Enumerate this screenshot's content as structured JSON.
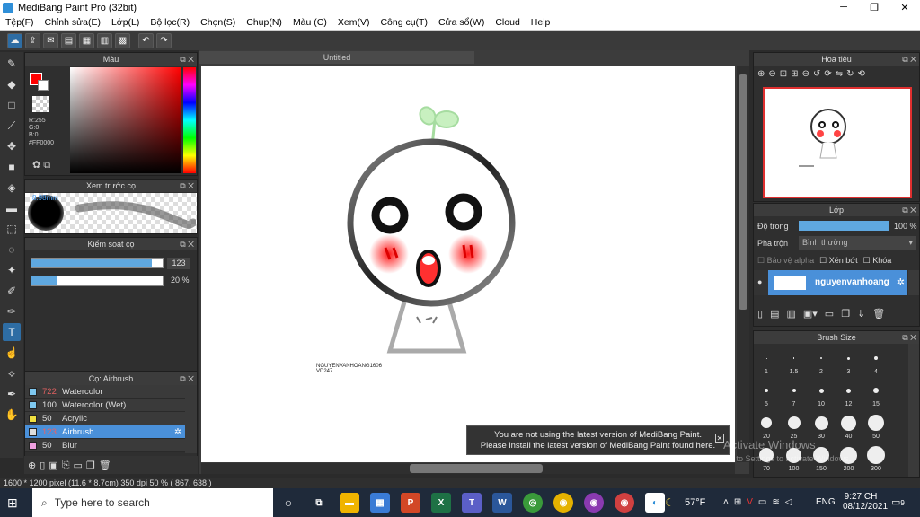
{
  "app": {
    "title": "MediBang Paint Pro (32bit)"
  },
  "menu": [
    "Tệp(F)",
    "Chỉnh sửa(E)",
    "Lớp(L)",
    "Bộ lọc(R)",
    "Chọn(S)",
    "Chụp(N)",
    "Màu (C)",
    "Xem(V)",
    "Công cụ(T)",
    "Cửa sổ(W)",
    "Cloud",
    "Help"
  ],
  "panels": {
    "color": "Màu",
    "preview": "Xem trước cọ",
    "control": "Kiểm soát cọ",
    "brush": "Cọ: Airbrush",
    "navigator": "Hoa tiêu",
    "layer": "Lớp",
    "brushsize": "Brush Size"
  },
  "color": {
    "r": "R:255",
    "g": "G:0",
    "b": "B:0",
    "hex": "#FF0000",
    "primary": "#ff0000"
  },
  "preview": {
    "size": "8.98mm"
  },
  "control": {
    "size": "123",
    "opacity": "20 %",
    "size_fill": 0.92,
    "opacity_fill": 0.2
  },
  "brushes": [
    {
      "size": "722",
      "name": "Watercolor",
      "color": "#7ec8f0"
    },
    {
      "size": "100",
      "name": "Watercolor (Wet)",
      "color": "#7ec8f0"
    },
    {
      "size": "50",
      "name": "Acrylic",
      "color": "#f0e040"
    },
    {
      "size": "123",
      "name": "Airbrush",
      "color": "#dddddd"
    },
    {
      "size": "50",
      "name": "Blur",
      "color": "#f0a0e0"
    }
  ],
  "doc": {
    "tab": "Untitled",
    "signature1": "NGUYENVANHOANG1606",
    "signature2": "VD247"
  },
  "layer": {
    "opacity_label": "Độ trong",
    "opacity": "100 %",
    "opacity_fill": 1,
    "blend_label": "Pha trộn",
    "blend": "Bình thường",
    "protect": "Bảo vệ alpha",
    "clip": "Xén bớt",
    "lock": "Khóa",
    "layer_name": "nguyenvanhoang"
  },
  "brushsize": {
    "row1": [
      "1",
      "1.5",
      "2",
      "3",
      "4"
    ],
    "row2": [
      "5",
      "7",
      "10",
      "12",
      "15"
    ],
    "row3": [
      "20",
      "25",
      "30",
      "40",
      "50"
    ],
    "row4": [
      "70",
      "100",
      "150",
      "200",
      "300"
    ]
  },
  "notice": {
    "line1": "You are not using the latest version of MediBang Paint.",
    "line2": "Please install the latest version of MediBang Paint found here."
  },
  "watermark": {
    "line1": "Activate Windows",
    "line2": "Go to Settings to activate Windows."
  },
  "status": "1600 * 1200 pixel   (11.6 * 8.7cm)   350 dpi   50 %   ( 867, 638 )",
  "taskbar": {
    "search": "Type here to search",
    "weather": "57°F",
    "lang": "ENG",
    "time": "9:27 CH",
    "date": "08/12/2021",
    "notif": "9"
  }
}
